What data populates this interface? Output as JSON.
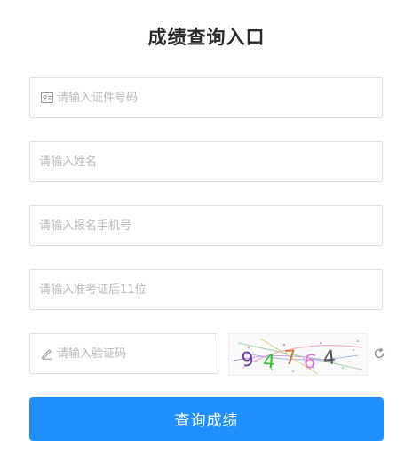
{
  "page": {
    "title": "成绩查询入口"
  },
  "form": {
    "id_number": {
      "placeholder": "请输入证件号码",
      "value": ""
    },
    "name": {
      "placeholder": "请输入姓名",
      "value": ""
    },
    "phone": {
      "placeholder": "请输入报名手机号",
      "value": ""
    },
    "ticket": {
      "placeholder": "请输入准考证后11位",
      "value": ""
    },
    "captcha": {
      "placeholder": "请输入验证码",
      "value": ""
    }
  },
  "captcha_image": {
    "text": "9476 4",
    "chars": [
      "9",
      "4",
      "7",
      "6",
      "4"
    ],
    "colors": [
      "#6a3fb0",
      "#3ec13e",
      "#d6803a",
      "#d87ad8",
      "#555555"
    ]
  },
  "icons": {
    "id_icon": "id-card-icon",
    "captcha_icon": "pencil-icon",
    "refresh_icon": "refresh-icon"
  },
  "submit": {
    "label": "查询成绩"
  },
  "theme": {
    "accent": "#1e90ff",
    "border": "#dcdfe6",
    "placeholder": "#b5b8bd"
  }
}
